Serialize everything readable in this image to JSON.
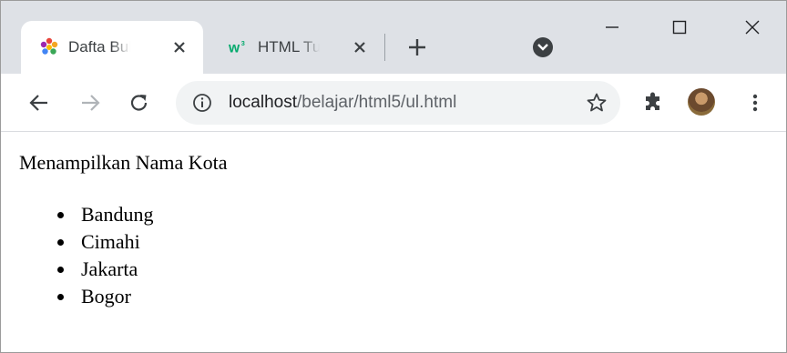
{
  "tabs": [
    {
      "title": "Dafta Bull",
      "icon": "puzzle-flower-icon",
      "active": true
    },
    {
      "title": "HTML Tut",
      "icon": "w3schools-icon",
      "active": false
    }
  ],
  "address_bar": {
    "host": "localhost",
    "path": "/belajar/html5/ul.html"
  },
  "page": {
    "heading": "Menampilkan Nama Kota",
    "cities": [
      "Bandung",
      "Cimahi",
      "Jakarta",
      "Bogor"
    ]
  },
  "colors": {
    "tabstrip": "#dee1e6",
    "omnibox": "#f1f3f4",
    "w3_logo": "#04aa6d"
  }
}
